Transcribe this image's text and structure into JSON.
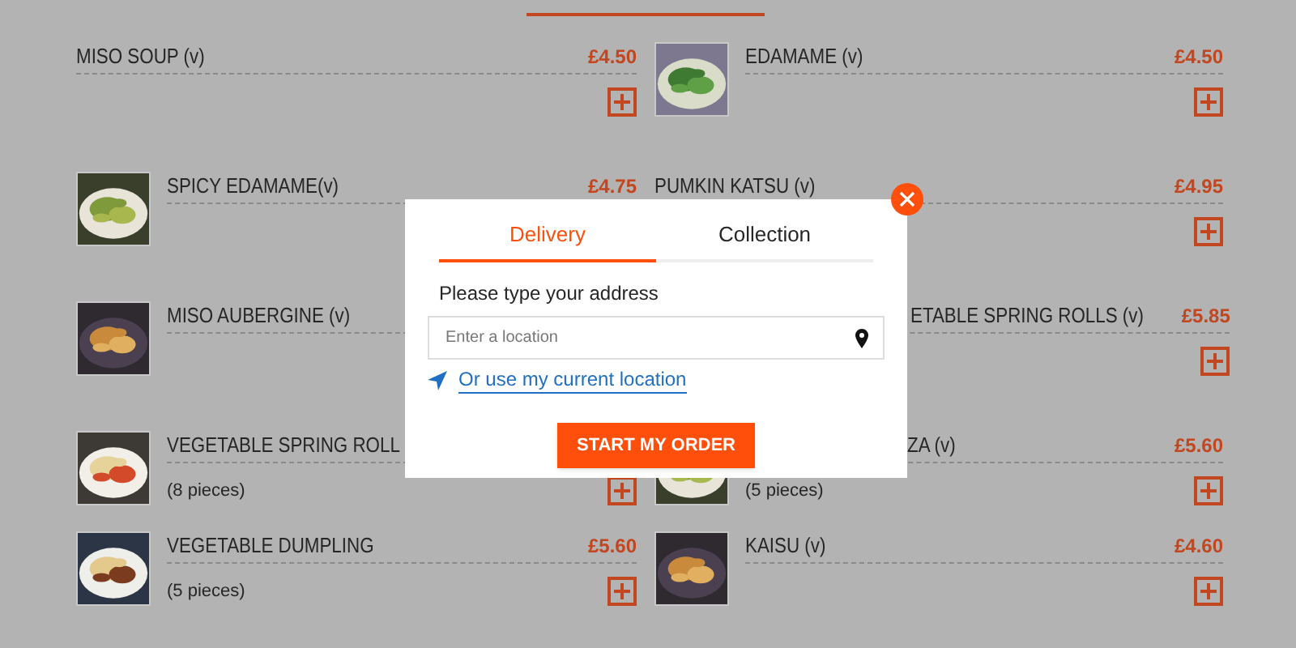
{
  "columns": [
    {
      "items": [
        {
          "name": "MISO SOUP (v)",
          "price": "£4.50",
          "add_button": true
        },
        {
          "name": "SPICY EDAMAME(v)",
          "price": "£4.75",
          "kind": "picture",
          "add_button": false
        },
        {
          "name": "MISO AUBERGINE (v)",
          "kind": "picture",
          "add_button": false
        },
        {
          "name": "VEGETABLE SPRING ROLL",
          "kind": "picture",
          "description": "(8 pieces)",
          "add_button": true
        },
        {
          "name": "VEGETABLE DUMPLING",
          "price": "£5.60",
          "kind": "picture",
          "description": "(5 pieces)",
          "add_button": true
        }
      ]
    },
    {
      "items": [
        {
          "name": "EDAMAME (v)",
          "price": "£4.50",
          "kind": "picture",
          "add_button": true
        },
        {
          "name": "PUMKIN KATSU (v)",
          "price": "£4.95",
          "add_button": true
        },
        {
          "name": "ETABLE SPRING ROLLS (v)",
          "price": "£5.85",
          "covered": true,
          "add_button": true
        },
        {
          "name": "ZA (v)",
          "price": "£5.60",
          "kind": "picture",
          "covered": true,
          "description": "(5 pieces)",
          "add_button": true
        },
        {
          "name": "KAISU (v)",
          "price": "£4.60",
          "kind": "picture",
          "add_button": true
        }
      ]
    }
  ],
  "dialog": {
    "tabs": [
      {
        "label": "Delivery",
        "selected": true
      },
      {
        "label": "Collection",
        "selected": false
      }
    ],
    "address_label": "Please type your address",
    "address_field": {
      "placeholder": "Enter a location"
    },
    "location_link": "Or use my current location",
    "start_button": "START MY ORDER"
  }
}
